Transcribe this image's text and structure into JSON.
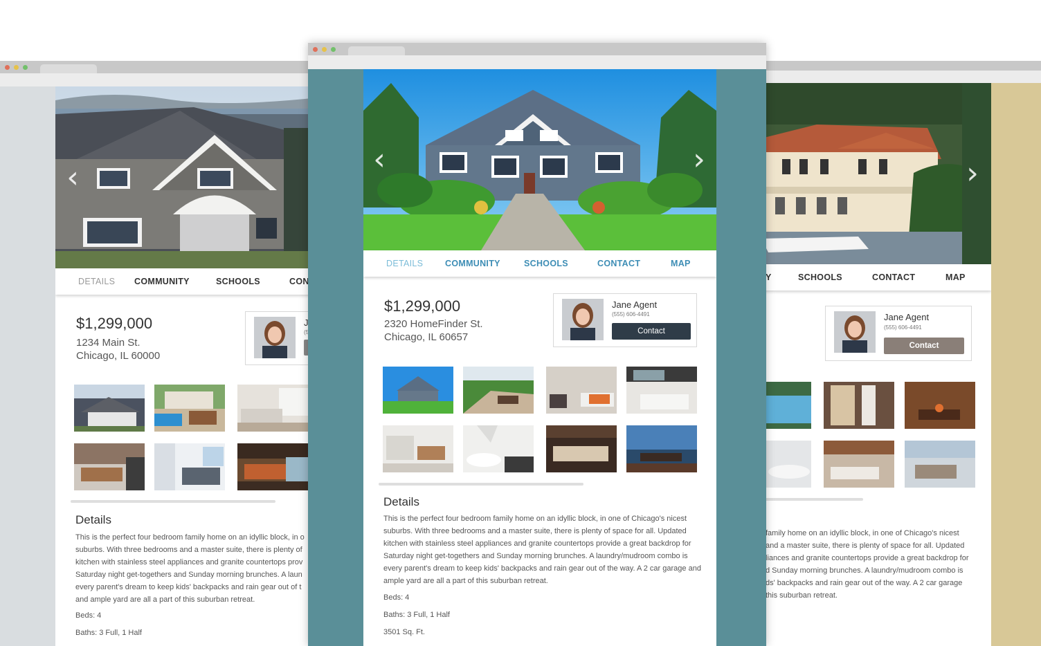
{
  "listing_center": {
    "nav": [
      "DETAILS",
      "COMMUNITY",
      "SCHOOLS",
      "CONTACT",
      "MAP"
    ],
    "price": "$1,299,000",
    "address_line1": "2320 HomeFinder St.",
    "address_line2": "Chicago, IL 60657",
    "agent": {
      "name": "Jane Agent",
      "phone": "(555) 606-4491",
      "button": "Contact"
    },
    "details_heading": "Details",
    "description": "This is the perfect four bedroom family home on an idyllic block, in one of Chicago's nicest suburbs. With three bedrooms and a master suite, there is plenty of space for all. Updated kitchen with stainless steel appliances and granite countertops provide a great backdrop for Saturday night get-togethers and Sunday morning brunches. A laundry/mudroom combo is every parent's dream to keep kids' backpacks and rain gear out of the way. A 2 car garage and ample yard are all a part of this suburban retreat.",
    "beds": "Beds: 4",
    "baths": "Baths: 3 Full, 1 Half",
    "sqft": "3501 Sq. Ft."
  },
  "listing_left": {
    "nav": [
      "DETAILS",
      "COMMUNITY",
      "SCHOOLS",
      "CON"
    ],
    "price": "$1,299,000",
    "address_line1": "1234 Main St.",
    "address_line2": "Chicago, IL 60000",
    "agent_initial": "J",
    "agent_phone_fragment": "(5",
    "details_heading": "Details",
    "description_lines": [
      "This is the perfect four bedroom family home on an idyllic block, in o",
      "suburbs. With three bedrooms and a master suite, there is plenty of",
      "kitchen with stainless steel appliances and granite countertops prov",
      "Saturday night get-togethers and Sunday morning brunches. A laun",
      "every parent's dream to keep kids' backpacks and rain gear out of t",
      "and ample yard are all a part of this suburban retreat."
    ],
    "beds": "Beds: 4",
    "baths": "Baths: 3 Full, 1 Half"
  },
  "listing_right": {
    "nav": [
      "Y",
      "SCHOOLS",
      "CONTACT",
      "MAP"
    ],
    "agent": {
      "name": "Jane Agent",
      "phone": "(555) 606-4491",
      "button": "Contact"
    },
    "description_lines": [
      "family home on an idyllic block, in one of Chicago's nicest",
      "and a master suite, there is plenty of space for all. Updated",
      "liances and granite countertops provide a great backdrop for",
      "d Sunday morning brunches. A laundry/mudroom combo is",
      "ds' backpacks and rain gear out of the way. A 2 car garage",
      "this suburban retreat."
    ]
  },
  "icons": {
    "prev": "chevron-left-icon",
    "next": "chevron-right-icon"
  },
  "colors": {
    "center_frame": "#5a8f98",
    "center_nav_active": "#7bbcd8",
    "center_nav": "#3d8db5",
    "center_button": "#2f3c48",
    "right_frame": "#d8c897",
    "right_button": "#8a7f78",
    "left_frame": "#d9dde0"
  }
}
